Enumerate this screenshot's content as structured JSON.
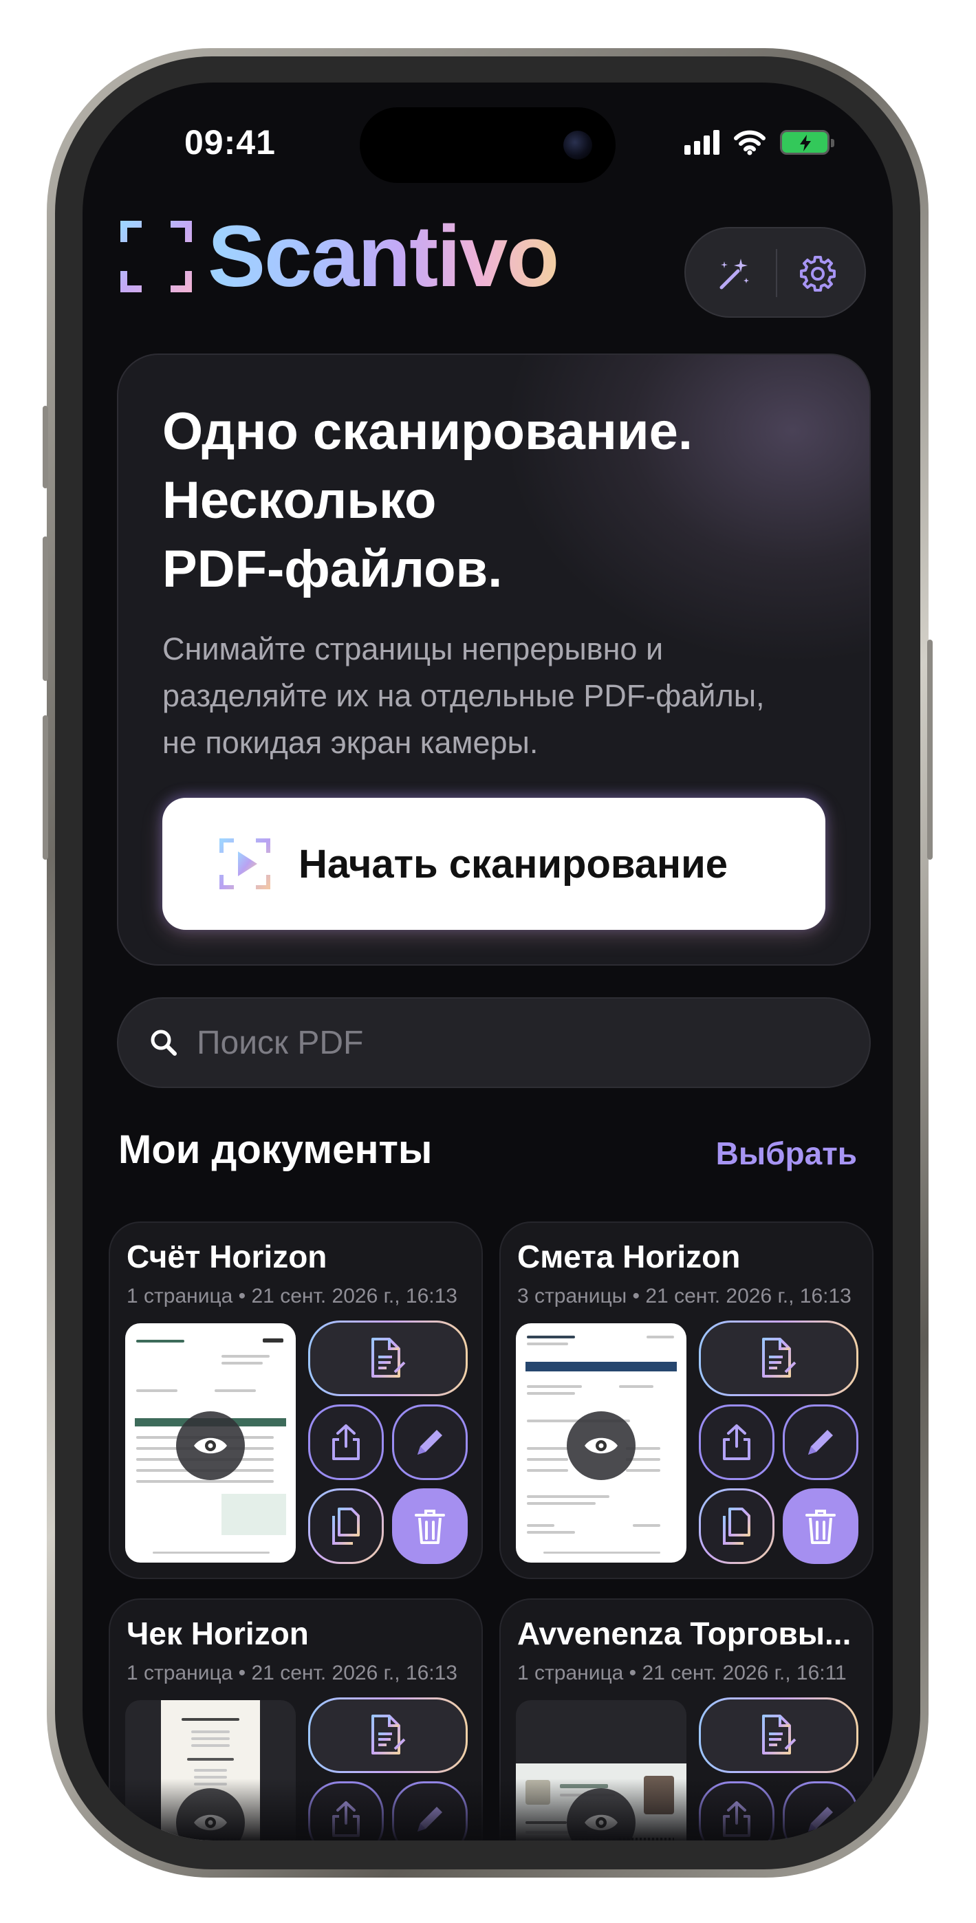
{
  "status_bar": {
    "time": "09:41"
  },
  "header": {
    "app_name": "Scantivo",
    "magic_icon": "magic-wand-sparkles",
    "settings_icon": "gear"
  },
  "hero": {
    "title": "Одно сканирование.\nНесколько\nPDF-файлов.",
    "subtitle": "Снимайте страницы непрерывно и\nразделяйте их на отдельные PDF-файлы,\nне покидая экран камеры.",
    "button_label": "Начать сканирование"
  },
  "search": {
    "placeholder": "Поиск PDF"
  },
  "documents_section": {
    "title": "Мои документы",
    "select_label": "Выбрать"
  },
  "documents": [
    {
      "title": "Счёт Horizon",
      "meta": "1 страница • 21 сент. 2026 г., 16:13"
    },
    {
      "title": "Смета Horizon",
      "meta": "3 страницы • 21 сент. 2026 г., 16:13"
    },
    {
      "title": "Чек Horizon",
      "meta": "1 страница • 21 сент. 2026 г., 16:13"
    },
    {
      "title": "Avvenenza Торговы...",
      "meta": "1 страница • 21 сент. 2026 г., 16:11"
    }
  ],
  "colors": {
    "accent": "#a795f4",
    "delete": "#a58ff0",
    "background": "#0c0c0f",
    "card": "#18181c"
  }
}
